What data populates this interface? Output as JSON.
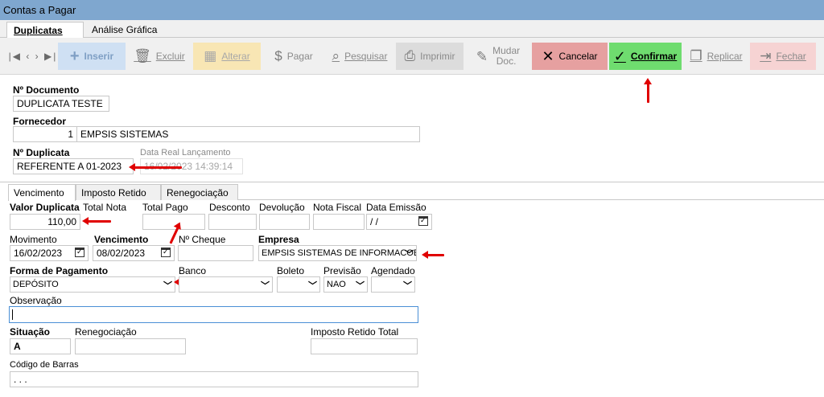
{
  "window": {
    "title": "Contas a Pagar"
  },
  "main_tabs": [
    "Duplicatas",
    "Análise Gráfica"
  ],
  "toolbar": {
    "nav": "|◀ ‹ › ▶|",
    "inserir": "Inserir",
    "excluir": "Excluir",
    "alterar": "Alterar",
    "pagar": "Pagar",
    "pesquisar": "Pesquisar",
    "imprimir": "Imprimir",
    "mudar_line1": "Mudar",
    "mudar_line2": "Doc.",
    "cancelar": "Cancelar",
    "confirmar": "Confirmar",
    "replicar": "Replicar",
    "fechar": "Fechar"
  },
  "header": {
    "documento_label": "Nº Documento",
    "documento_value": "DUPLICATA TESTE",
    "fornecedor_label": "Fornecedor",
    "fornecedor_code": "1",
    "fornecedor_name": "EMPSIS SISTEMAS",
    "duplicata_label": "Nº Duplicata",
    "duplicata_value": "REFERENTE A 01-2023",
    "data_real_label": "Data Real Lançamento",
    "data_real_value": "16/02/2023 14:39:14"
  },
  "sub_tabs": [
    "Vencimento",
    "Imposto Retido",
    "Renegociação"
  ],
  "vencimento": {
    "valor_duplicata_label": "Valor Duplicata",
    "valor_duplicata_value": "110,00",
    "total_nota_label": "Total Nota",
    "total_pago_label": "Total  Pago",
    "desconto_label": "Desconto",
    "devolucao_label": "Devolução",
    "nota_fiscal_label": "Nota Fiscal",
    "data_emissao_label": "Data Emissão",
    "data_emissao_value": " /  /",
    "movimento_label": "Movimento",
    "movimento_value": "16/02/2023",
    "vencimento_label": "Vencimento",
    "vencimento_value": "08/02/2023",
    "cheque_label": "Nº Cheque",
    "empresa_label": "Empresa",
    "empresa_value": "EMPSIS SISTEMAS DE INFORMACOES LTDA",
    "forma_pagamento_label": "Forma de Pagamento",
    "forma_pagamento_value": "DEPÓSITO",
    "banco_label": "Banco",
    "boleto_label": "Boleto",
    "previsao_label": "Previsão",
    "previsao_value": "NAO",
    "agendado_label": "Agendado",
    "observacao_label": "Observação",
    "situacao_label": "Situação",
    "situacao_value": "A",
    "renegociacao_label": "Renegociação",
    "imposto_retido_total_label": "Imposto Retido Total",
    "codigo_barras_label": "Código de Barras",
    "codigo_barras_value": "     .     .     ."
  }
}
